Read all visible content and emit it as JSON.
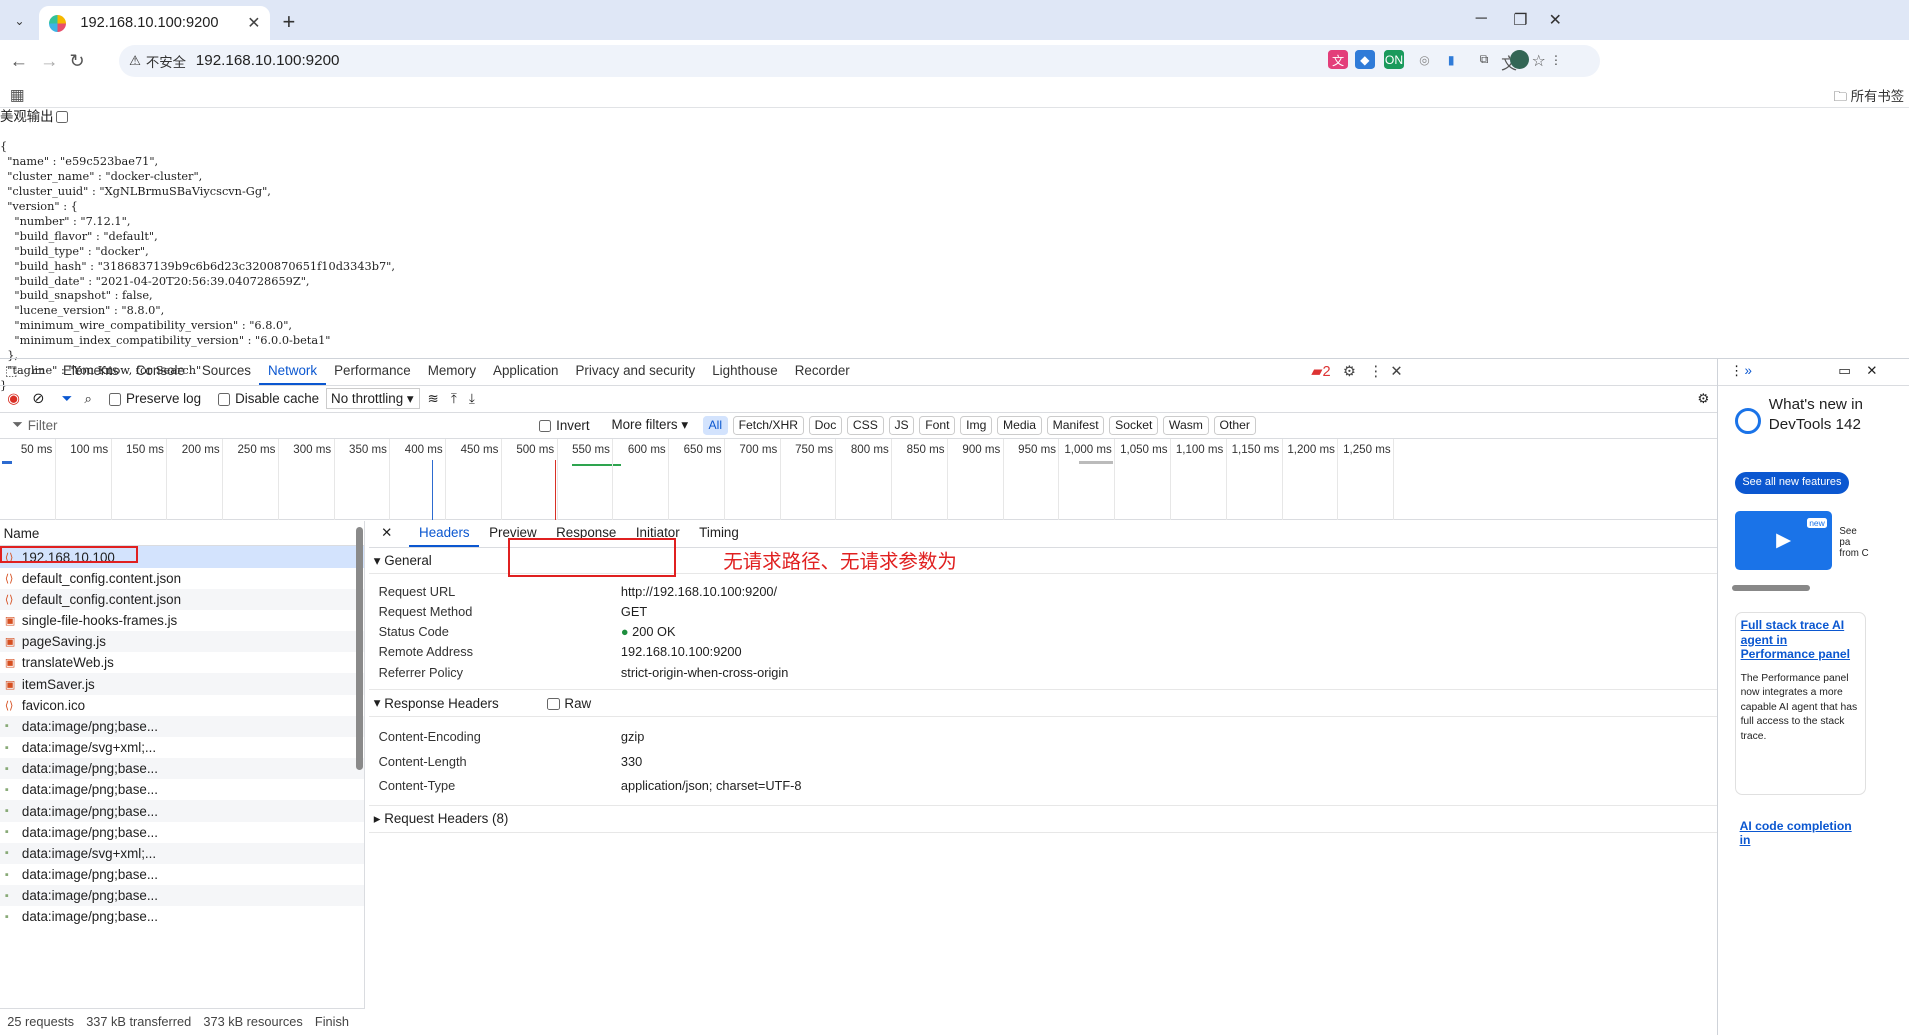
{
  "browser": {
    "tab_title": "192.168.10.100:9200",
    "security_label": "不安全",
    "url": "192.168.10.100:9200",
    "bookmarks_all": "所有书签"
  },
  "page": {
    "pretty_label": "美观输出",
    "json_lines": [
      "{",
      "  \"name\" : \"e59c523bae71\",",
      "  \"cluster_name\" : \"docker-cluster\",",
      "  \"cluster_uuid\" : \"XgNLBrmuSBaViycscvn-Gg\",",
      "  \"version\" : {",
      "    \"number\" : \"7.12.1\",",
      "    \"build_flavor\" : \"default\",",
      "    \"build_type\" : \"docker\",",
      "    \"build_hash\" : \"3186837139b9c6b6d23c3200870651f10d3343b7\",",
      "    \"build_date\" : \"2021-04-20T20:56:39.040728659Z\",",
      "    \"build_snapshot\" : false,",
      "    \"lucene_version\" : \"8.8.0\",",
      "    \"minimum_wire_compatibility_version\" : \"6.8.0\",",
      "    \"minimum_index_compatibility_version\" : \"6.0.0-beta1\"",
      "  },",
      "  \"tagline\" : \"You Know, for Search\"",
      "}"
    ]
  },
  "devtools": {
    "tabs": [
      "Elements",
      "Console",
      "Sources",
      "Network",
      "Performance",
      "Memory",
      "Application",
      "Privacy and security",
      "Lighthouse",
      "Recorder"
    ],
    "issues_count": "2",
    "controls": {
      "preserve_log": "Preserve log",
      "disable_cache": "Disable cache",
      "throttling": "No throttling"
    },
    "filter": {
      "placeholder": "Filter",
      "invert": "Invert",
      "more_filters": "More filters",
      "chips": [
        "All",
        "Fetch/XHR",
        "Doc",
        "CSS",
        "JS",
        "Font",
        "Img",
        "Media",
        "Manifest",
        "Socket",
        "Wasm",
        "Other"
      ]
    },
    "ticks": [
      "50 ms",
      "100 ms",
      "150 ms",
      "200 ms",
      "250 ms",
      "300 ms",
      "350 ms",
      "400 ms",
      "450 ms",
      "500 ms",
      "550 ms",
      "600 ms",
      "650 ms",
      "700 ms",
      "750 ms",
      "800 ms",
      "850 ms",
      "900 ms",
      "950 ms",
      "1,000 ms",
      "1,050 ms",
      "1,100 ms",
      "1,150 ms",
      "1,200 ms",
      "1,250 ms"
    ],
    "name_header": "Name",
    "requests": [
      "192.168.10.100",
      "default_config.content.json",
      "default_config.content.json",
      "single-file-hooks-frames.js",
      "pageSaving.js",
      "translateWeb.js",
      "itemSaver.js",
      "favicon.ico",
      "data:image/png;base...",
      "data:image/svg+xml;...",
      "data:image/png;base...",
      "data:image/png;base...",
      "data:image/png;base...",
      "data:image/png;base...",
      "data:image/svg+xml;...",
      "data:image/png;base...",
      "data:image/png;base...",
      "data:image/png;base..."
    ],
    "status_bar": [
      "25 requests",
      "337 kB transferred",
      "373 kB resources",
      "Finish"
    ],
    "detail_tabs": [
      "Headers",
      "Preview",
      "Response",
      "Initiator",
      "Timing"
    ],
    "general_title": "General",
    "general": [
      {
        "k": "Request URL",
        "v": "http://192.168.10.100:9200/"
      },
      {
        "k": "Request Method",
        "v": "GET"
      },
      {
        "k": "Status Code",
        "v": "200 OK"
      },
      {
        "k": "Remote Address",
        "v": "192.168.10.100:9200"
      },
      {
        "k": "Referrer Policy",
        "v": "strict-origin-when-cross-origin"
      }
    ],
    "response_headers_title": "Response Headers",
    "raw_label": "Raw",
    "response_headers": [
      {
        "k": "Content-Encoding",
        "v": "gzip"
      },
      {
        "k": "Content-Length",
        "v": "330"
      },
      {
        "k": "Content-Type",
        "v": "application/json; charset=UTF-8"
      }
    ],
    "request_headers_title": "Request Headers (8)",
    "annotation": "无请求路径、无请求参数为",
    "whats_new": {
      "title": "What's new in DevTools 142",
      "button": "See all new features",
      "card_text": "See pa from C",
      "new_badge": "new",
      "link1": "Full stack trace AI agent in Performance panel",
      "body1": "The Performance panel now integrates a more capable AI agent that has full access to the stack trace.",
      "link2": "AI code completion in"
    }
  }
}
